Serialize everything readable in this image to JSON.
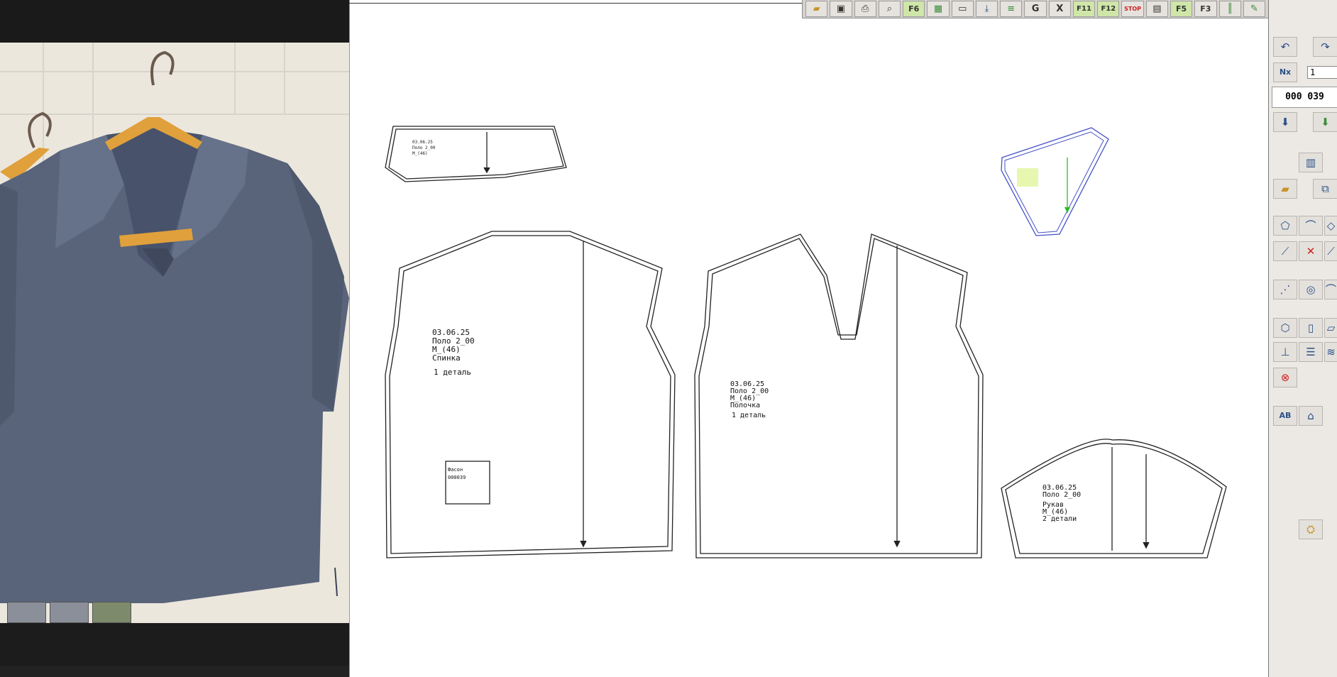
{
  "photo_viewer": {
    "thumbnails": [
      "thumb-1",
      "thumb-2",
      "thumb-3"
    ]
  },
  "pattern_pieces": {
    "back": {
      "line1": "03.06.25",
      "line2": "Поло 2_00",
      "line3": "М_(46)",
      "line4": "Спинка",
      "line5": "1 деталь"
    },
    "front": {
      "line1": "03.06.25",
      "line2": "Поло 2_00",
      "line3": "М_(46)",
      "line4": "Полочка",
      "line5": "1 деталь"
    },
    "sleeve": {
      "line1": "03.06.25",
      "line2": "Поло 2_00",
      "line3": "Рукав",
      "line4": "М_(46)",
      "line5": "2 детали"
    },
    "label_box": {
      "line1": "Фасон",
      "line2": "000039"
    }
  },
  "right_panel": {
    "input_value": "1",
    "counter": "000 039"
  },
  "toolbar": {
    "icons": [
      "open-folder-icon",
      "save-icon",
      "print-icon",
      "zoom-icon",
      "f6-icon",
      "layers-icon",
      "measure-icon",
      "download-icon",
      "level-icon",
      "g-icon",
      "x-icon",
      "f11-icon",
      "f12-icon",
      "stop-icon",
      "ruler-icon",
      "f5-icon",
      "f3-icon",
      "columns-icon",
      "pen-icon"
    ],
    "labels": {
      "f6": "F6",
      "f11": "F11",
      "f12": "F12",
      "f5": "F5",
      "f3": "F3",
      "g": "G",
      "x": "X",
      "stop": "STOP"
    }
  },
  "colors": {
    "garment": "#59647a",
    "hanger": "#e0a03c",
    "wall": "#ece7dd",
    "dark_frame": "#1a1a1a",
    "pattern_line": "#222222",
    "yoke_outline": "#4450c8",
    "yoke_grain": "#1fbf1f",
    "panel_bg": "#ece9e4"
  }
}
